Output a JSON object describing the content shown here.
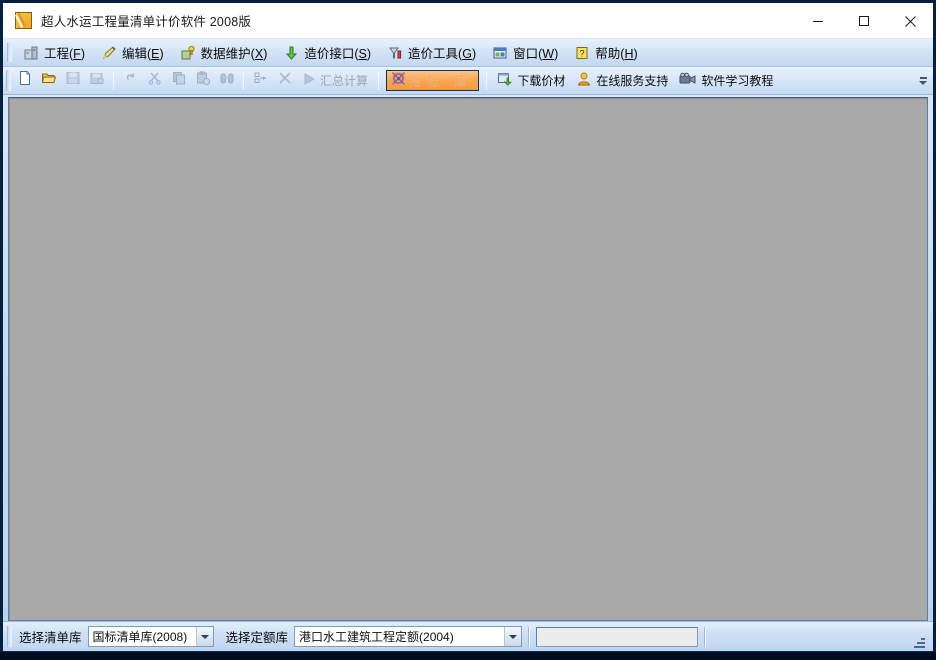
{
  "window": {
    "title": "超人水运工程量清单计价软件 2008版",
    "app_icon": "pencil-square-icon",
    "controls": {
      "minimize": "minimize-icon",
      "maximize": "maximize-icon",
      "close": "close-icon"
    }
  },
  "menu": {
    "items": [
      {
        "label": "工程(F)",
        "text": "工程(",
        "accel": "F",
        "tail": ")",
        "icon": "project-icon"
      },
      {
        "label": "编辑(E)",
        "text": "编辑(",
        "accel": "E",
        "tail": ")",
        "icon": "edit-pencil-icon"
      },
      {
        "label": "数据维护(X)",
        "text": "数据维护(",
        "accel": "X",
        "tail": ")",
        "icon": "data-maintenance-icon"
      },
      {
        "label": "造价接口(S)",
        "text": "造价接口(",
        "accel": "S",
        "tail": ")",
        "icon": "green-arrow-icon"
      },
      {
        "label": "造价工具(G)",
        "text": "造价工具(",
        "accel": "G",
        "tail": ")",
        "icon": "cost-tool-icon"
      },
      {
        "label": "窗口(W)",
        "text": "窗口(",
        "accel": "W",
        "tail": ")",
        "icon": "window-icon"
      },
      {
        "label": "帮助(H)",
        "text": "帮助(",
        "accel": "H",
        "tail": ")",
        "icon": "help-question-icon"
      }
    ]
  },
  "toolbar": {
    "buttons": [
      {
        "name": "new-file",
        "icon": "new-document-icon",
        "enabled": true
      },
      {
        "name": "open-file",
        "icon": "open-folder-icon",
        "enabled": true
      },
      {
        "name": "save-file",
        "icon": "save-disk-icon",
        "enabled": false
      },
      {
        "name": "save-as-file",
        "icon": "save-as-icon",
        "enabled": false
      },
      {
        "name": "undo",
        "icon": "undo-arrow-icon",
        "enabled": false
      },
      {
        "name": "cut",
        "icon": "scissors-icon",
        "enabled": false
      },
      {
        "name": "copy",
        "icon": "copy-icon",
        "enabled": false
      },
      {
        "name": "paste",
        "icon": "paste-icon",
        "enabled": false
      },
      {
        "name": "find",
        "icon": "binoculars-icon",
        "enabled": false
      },
      {
        "name": "indent",
        "icon": "indent-list-icon",
        "enabled": false
      },
      {
        "name": "delete",
        "icon": "cross-delete-icon",
        "enabled": false
      }
    ],
    "calc_label": "汇总计算",
    "calc_icon": "play-triangle-icon",
    "bid_label": "招标    库",
    "bid_icon": "bid-target-icon",
    "download_label": "下载价材",
    "download_icon": "download-green-icon",
    "support_label": "在线服务支持",
    "support_icon": "online-support-person-icon",
    "tutorial_label": "软件学习教程",
    "tutorial_icon": "video-camera-icon",
    "overflow_icon": "toolbar-overflow-icon"
  },
  "status": {
    "list_library_label": "选择清单库",
    "list_library_value": "国标清单库(2008)",
    "quota_library_label": "选择定额库",
    "quota_library_value": "港口水工建筑工程定额(2004)",
    "input_value": "",
    "input_placeholder": ""
  },
  "colors": {
    "accent_orange": "#f59a3f",
    "title_bar": "#ffffff",
    "chrome_blue": "#cfe0f3",
    "client_gray": "#a8a8a8",
    "outer_border": "#05203f"
  }
}
